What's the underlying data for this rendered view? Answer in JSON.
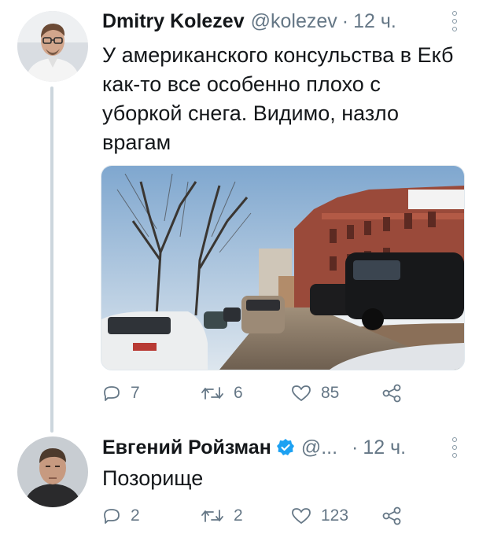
{
  "tweets": [
    {
      "author_name": "Dmitry Kolezev",
      "handle": "@kolezev",
      "separator": "·",
      "time": "12 ч.",
      "text": "У американского консульства в Екб как-то все особенно плохо с уборкой снега. Видимо, назло врагам",
      "replies": "7",
      "retweets": "6",
      "likes": "85"
    },
    {
      "author_name": "Евгений Ройзман",
      "handle": "@...",
      "separator": "·",
      "time": "12 ч.",
      "text": "Позорище",
      "replies": "2",
      "retweets": "2",
      "likes": "123",
      "verified": true
    }
  ],
  "colors": {
    "text": "#14171a",
    "secondary": "#657786",
    "verified": "#1da1f2",
    "thread_line": "#ccd6dd"
  },
  "icons": [
    "reply-icon",
    "retweet-icon",
    "like-icon",
    "share-icon",
    "more-icon",
    "verified-icon"
  ]
}
